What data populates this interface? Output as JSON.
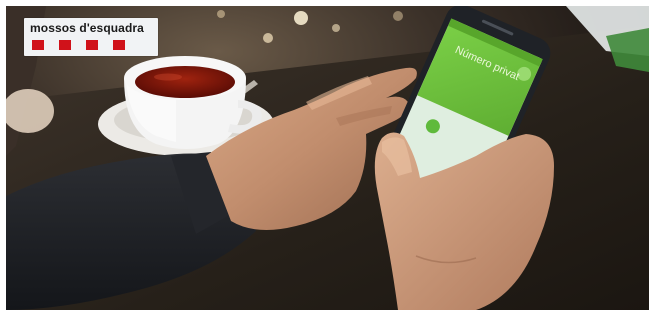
{
  "logo": {
    "text": "mossos d'esquadra",
    "stripe_color": "#d0121a",
    "background": "#f1f3f5"
  },
  "phone": {
    "screen_title": "Número privat",
    "status_label": "",
    "accent_green": "#6dc13b",
    "decline_button_color": "#e9444a"
  },
  "scene": {
    "cup_color": "#f2f2f2",
    "tea_color": "#6e1208",
    "table_color": "#2a221c"
  }
}
